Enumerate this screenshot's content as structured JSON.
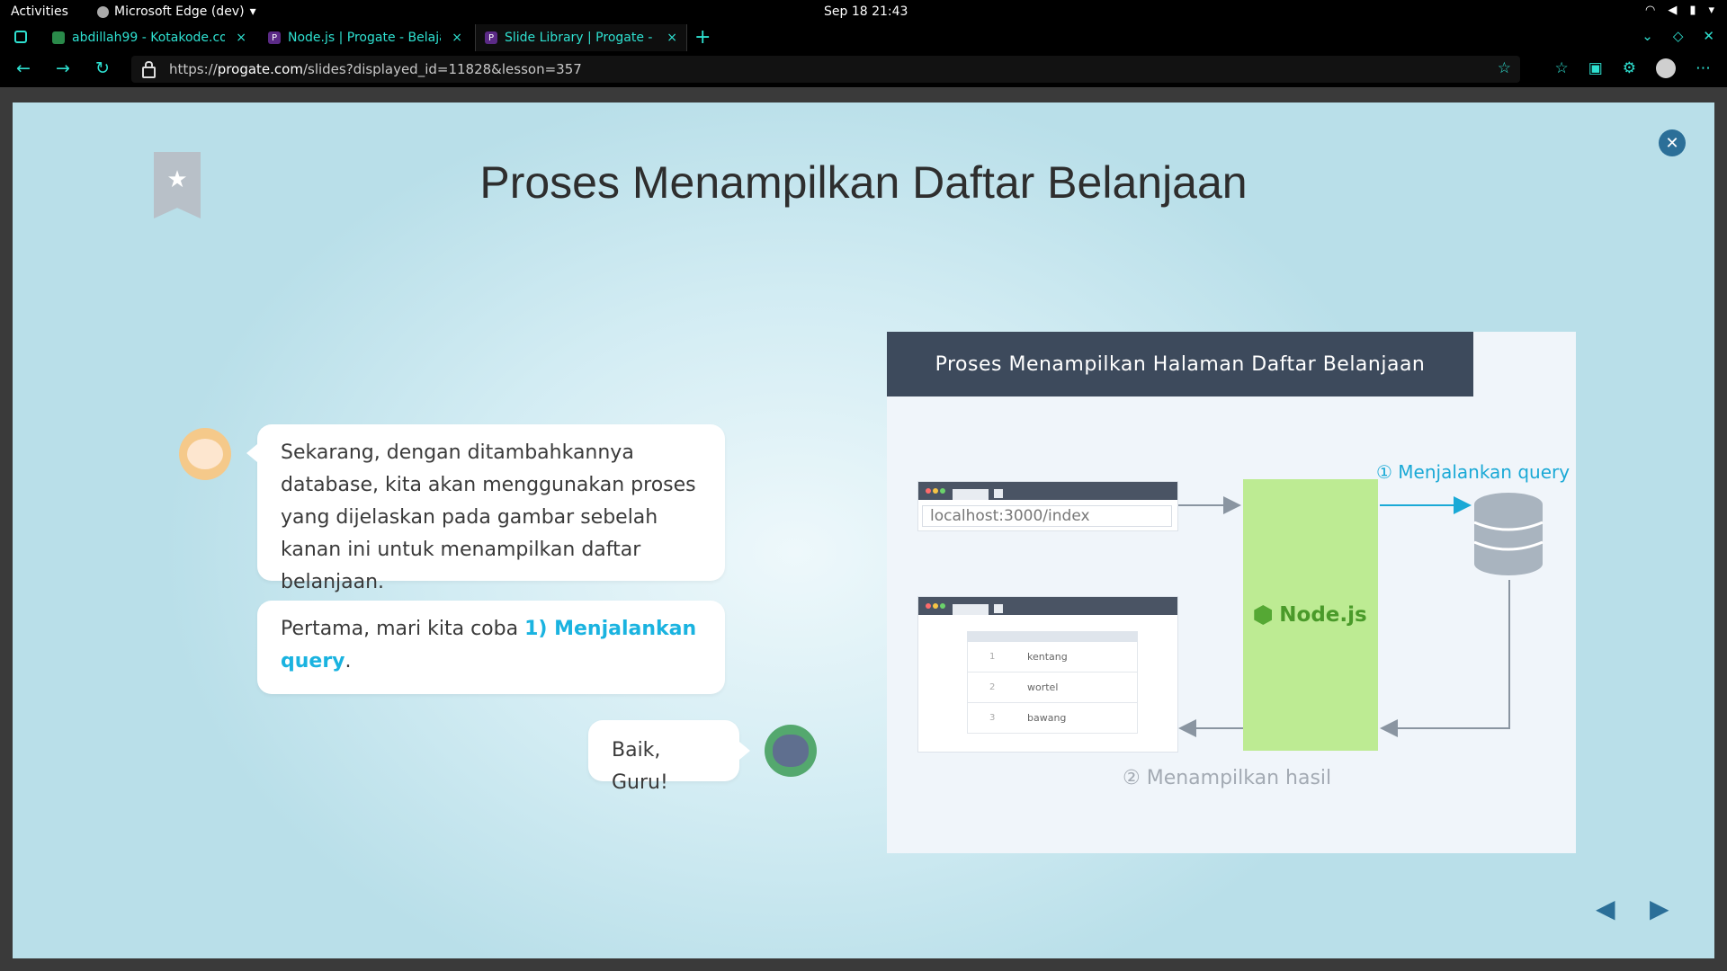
{
  "system": {
    "activities": "Activities",
    "app_menu": "Microsoft Edge (dev)",
    "clock": "Sep 18  21:43"
  },
  "browser": {
    "tabs": [
      {
        "title": "abdillah99 - Kotakode.com",
        "active": false
      },
      {
        "title": "Node.js | Progate - Belajar",
        "active": false
      },
      {
        "title": "Slide Library | Progate - Belajar",
        "active": true
      }
    ],
    "url_prefix": "https://",
    "url_host": "progate.com",
    "url_path": "/slides?displayed_id=11828&lesson=357",
    "accent_color": "#2ee0d0"
  },
  "slide": {
    "title": "Proses Menampilkan Daftar Belanjaan",
    "bubble1": "Sekarang, dengan ditambahkannya database, kita akan menggunakan proses yang dijelaskan pada gambar sebelah kanan ini untuk menampilkan daftar belanjaan.",
    "bubble2_prefix": "Pertama, mari kita coba ",
    "bubble2_highlight": "1) Menjalankan query",
    "bubble2_suffix": ".",
    "bubble3": "Baik, Guru!",
    "highlight_color": "#1ab3e0"
  },
  "diagram": {
    "title": "Proses Menampilkan Halaman Daftar Belanjaan",
    "url_text": "localhost:3000/index",
    "server_label": "Node.js",
    "step1": "① Menjalankan query",
    "step2": "② Menampilkan hasil",
    "rows": [
      {
        "num": "1",
        "item": "kentang"
      },
      {
        "num": "2",
        "item": "wortel"
      },
      {
        "num": "3",
        "item": "bawang"
      }
    ]
  }
}
